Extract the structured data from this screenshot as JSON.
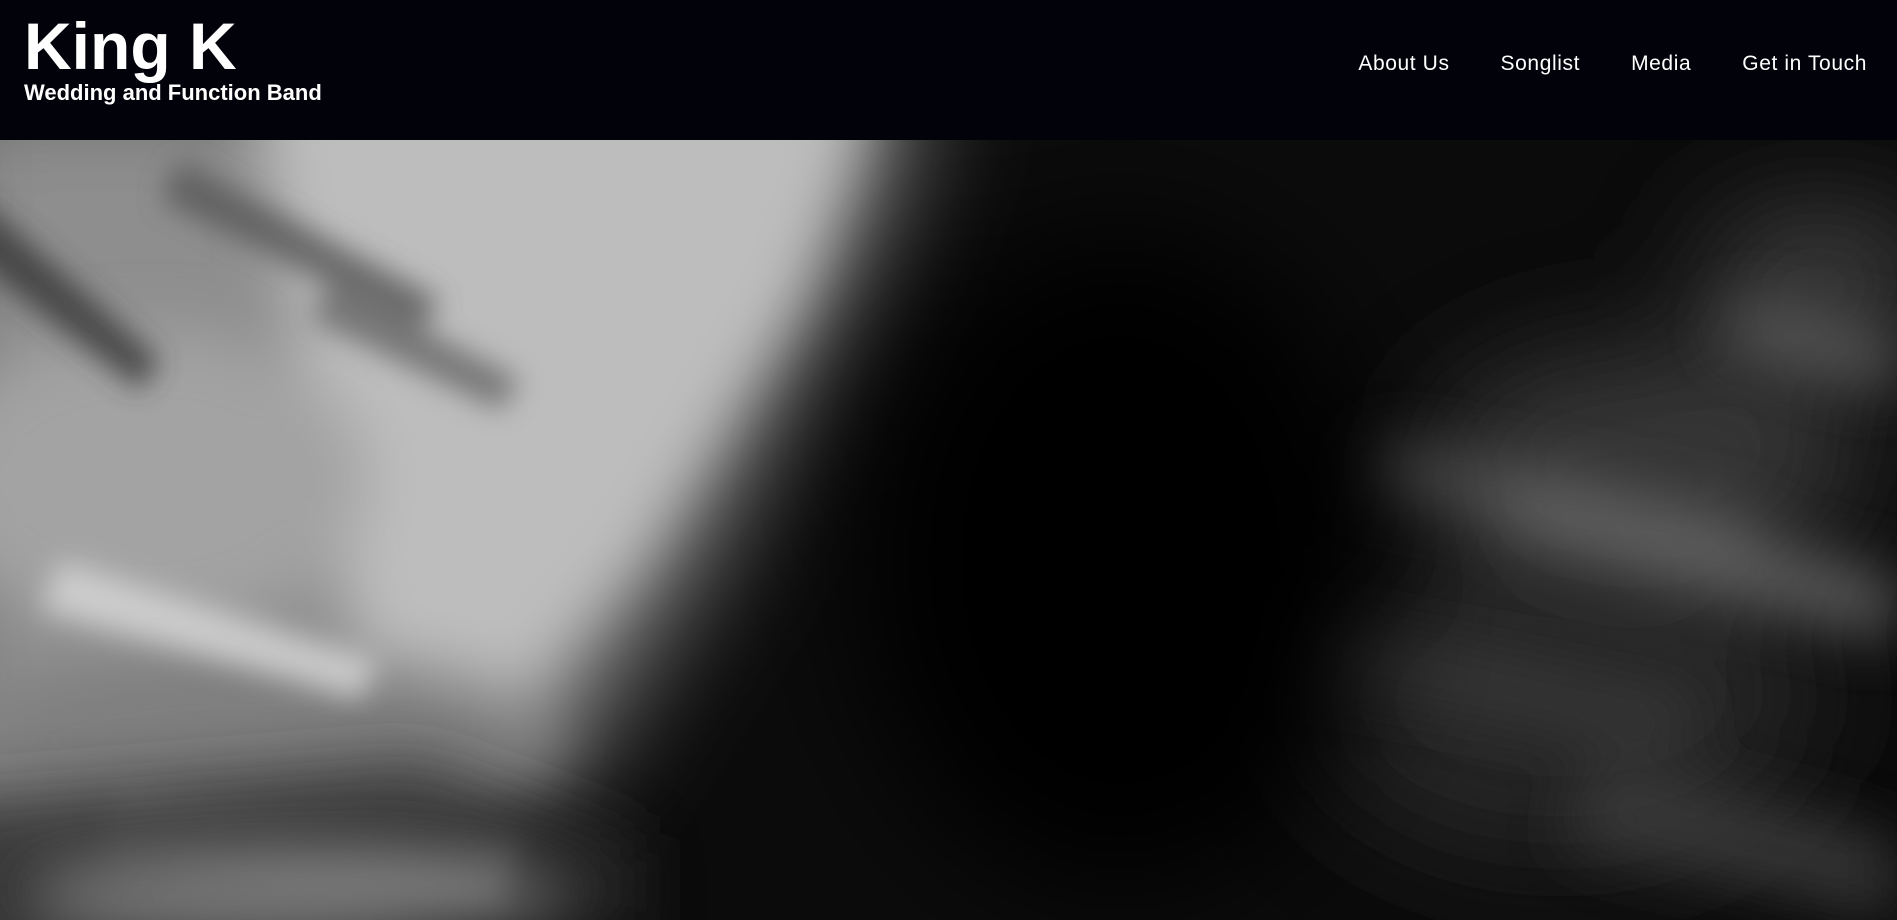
{
  "header": {
    "brand_title": "King K",
    "brand_tagline": "Wedding and Function Band",
    "background_color": "#02020a",
    "text_color": "#ffffff"
  },
  "nav": {
    "items": [
      {
        "label": "About Us"
      },
      {
        "label": "Songlist"
      },
      {
        "label": "Media"
      },
      {
        "label": "Get in Touch"
      }
    ]
  },
  "hero": {
    "media_type": "video",
    "style": "blurred black-and-white"
  }
}
